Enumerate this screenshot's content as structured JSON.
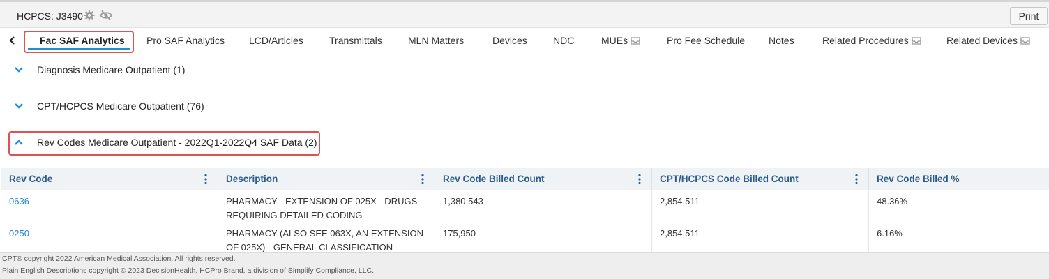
{
  "header": {
    "title": "HCPCS: J3490",
    "print_label": "Print"
  },
  "tabs": [
    {
      "label": "Fac SAF Analytics",
      "active": true
    },
    {
      "label": "Pro SAF Analytics"
    },
    {
      "label": "LCD/Articles"
    },
    {
      "label": "Transmittals"
    },
    {
      "label": "MLN Matters"
    },
    {
      "label": "Devices"
    },
    {
      "label": "NDC"
    },
    {
      "label": "MUEs",
      "icon": "tray-icon"
    },
    {
      "label": "Pro Fee Schedule"
    },
    {
      "label": "Notes"
    },
    {
      "label": "Related Procedures",
      "icon": "tray-icon"
    },
    {
      "label": "Related Devices",
      "icon": "tray-icon"
    }
  ],
  "accordions": [
    {
      "label": "Diagnosis Medicare Outpatient (1)",
      "expanded": false
    },
    {
      "label": "CPT/HCPCS Medicare Outpatient (76)",
      "expanded": false
    },
    {
      "label": "Rev Codes Medicare Outpatient - 2022Q1-2022Q4 SAF Data (2)",
      "expanded": true
    }
  ],
  "table": {
    "columns": [
      "Rev Code",
      "Description",
      "Rev Code Billed Count",
      "CPT/HCPCS Code Billed Count",
      "Rev Code Billed %"
    ],
    "rows": [
      [
        "0636",
        "PHARMACY - EXTENSION OF 025X - DRUGS REQUIRING DETAILED CODING",
        "1,380,543",
        "2,854,511",
        "48.36%"
      ],
      [
        "0250",
        "PHARMACY (ALSO SEE 063X, AN EXTENSION OF 025X) - GENERAL CLASSIFICATION",
        "175,950",
        "2,854,511",
        "6.16%"
      ]
    ]
  },
  "footer": {
    "line1": "CPT® copyright 2022 American Medical Association. All rights reserved.",
    "line2": "Plain English Descriptions copyright © 2023 DecisionHealth, HCPro Brand, a division of Simplify Compliance, LLC."
  },
  "colors": {
    "accent": "#1e8fd6",
    "highlight_box": "#e05252",
    "header_text": "#2a5b8a"
  }
}
